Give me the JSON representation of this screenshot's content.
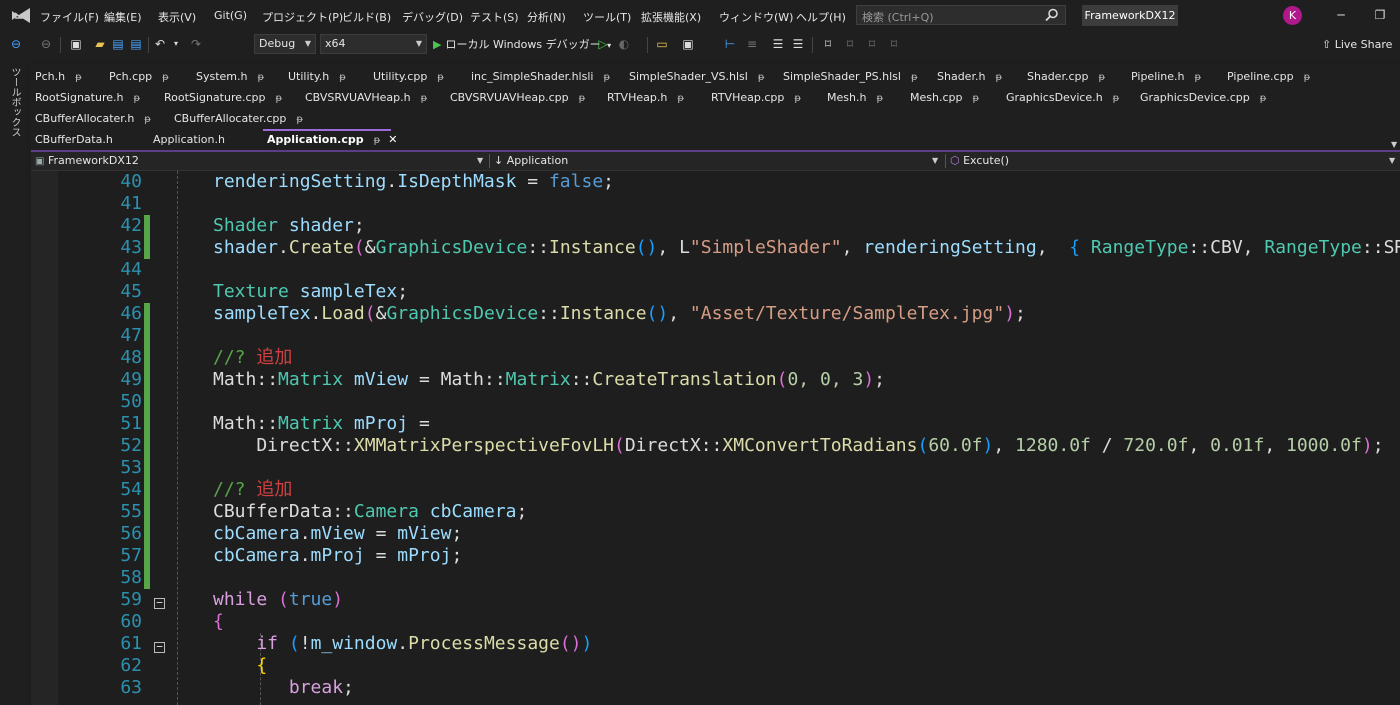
{
  "menu": {
    "items": [
      "ファイル(F)",
      "編集(E)",
      "表示(V)",
      "Git(G)",
      "プロジェクト(P)",
      "ビルド(B)",
      "デバッグ(D)",
      "テスト(S)",
      "分析(N)",
      "ツール(T)",
      "拡張機能(X)",
      "ウィンドウ(W)",
      "ヘルプ(H)"
    ],
    "search_placeholder": "検索 (Ctrl+Q)",
    "solution_name": "FrameworkDX12",
    "avatar_initial": "K"
  },
  "toolbar": {
    "config": "Debug",
    "platform": "x64",
    "run_label": "ローカル Windows デバッガー",
    "live_share": "Live Share"
  },
  "toolbox_label": "ツールボックス",
  "tabs": {
    "row1": [
      "Pch.h",
      "Pch.cpp",
      "System.h",
      "Utility.h",
      "Utility.cpp",
      "inc_SimpleShader.hlsli",
      "SimpleShader_VS.hlsl",
      "SimpleShader_PS.hlsl",
      "Shader.h",
      "Shader.cpp",
      "Pipeline.h",
      "Pipeline.cpp"
    ],
    "row2": [
      "RootSignature.h",
      "RootSignature.cpp",
      "CBVSRVUAVHeap.h",
      "CBVSRVUAVHeap.cpp",
      "RTVHeap.h",
      "RTVHeap.cpp",
      "Mesh.h",
      "Mesh.cpp",
      "GraphicsDevice.h",
      "GraphicsDevice.cpp"
    ],
    "row3": [
      "CBufferAllocater.h",
      "CBufferAllocater.cpp"
    ],
    "row4": [
      "CBufferData.h",
      "Application.h"
    ],
    "active": "Application.cpp"
  },
  "navbar": {
    "project": "FrameworkDX12",
    "scope": "Application",
    "member": "Excute()"
  },
  "editor": {
    "lines": [
      {
        "n": "40",
        "tokens": [
          [
            "renderingSetting",
            "var"
          ],
          [
            ".",
            "plain"
          ],
          [
            "IsDepthMask",
            "var"
          ],
          [
            " = ",
            "plain"
          ],
          [
            "false",
            "kw"
          ],
          [
            ";",
            "plain"
          ]
        ]
      },
      {
        "n": "41",
        "tokens": []
      },
      {
        "n": "42",
        "tokens": [
          [
            "Shader",
            "type"
          ],
          [
            " ",
            "plain"
          ],
          [
            "shader",
            "var"
          ],
          [
            ";",
            "plain"
          ]
        ]
      },
      {
        "n": "43",
        "tokens": [
          [
            "shader",
            "var"
          ],
          [
            ".",
            "plain"
          ],
          [
            "Create",
            "func"
          ],
          [
            "(",
            "br2"
          ],
          [
            "&",
            "plain"
          ],
          [
            "GraphicsDevice",
            "type"
          ],
          [
            "::",
            "plain"
          ],
          [
            "Instance",
            "func"
          ],
          [
            "()",
            "br3"
          ],
          [
            ", ",
            "plain"
          ],
          [
            "L",
            "plain"
          ],
          [
            "\"SimpleShader\"",
            "str"
          ],
          [
            ", ",
            "plain"
          ],
          [
            "renderingSetting",
            "var"
          ],
          [
            ", ",
            "plain"
          ],
          [
            " { ",
            "br3"
          ],
          [
            "RangeType",
            "type"
          ],
          [
            "::",
            "plain"
          ],
          [
            "CBV",
            "plain"
          ],
          [
            ", ",
            "plain"
          ],
          [
            "RangeType",
            "type"
          ],
          [
            "::",
            "plain"
          ],
          [
            "SRV",
            "plain"
          ],
          [
            " }",
            "br3"
          ],
          [
            ")",
            "br2"
          ],
          [
            ";",
            "plain"
          ]
        ]
      },
      {
        "n": "44",
        "tokens": []
      },
      {
        "n": "45",
        "tokens": [
          [
            "Texture",
            "type"
          ],
          [
            " ",
            "plain"
          ],
          [
            "sampleTex",
            "var"
          ],
          [
            ";",
            "plain"
          ]
        ]
      },
      {
        "n": "46",
        "tokens": [
          [
            "sampleTex",
            "var"
          ],
          [
            ".",
            "plain"
          ],
          [
            "Load",
            "func"
          ],
          [
            "(",
            "br2"
          ],
          [
            "&",
            "plain"
          ],
          [
            "GraphicsDevice",
            "type"
          ],
          [
            "::",
            "plain"
          ],
          [
            "Instance",
            "func"
          ],
          [
            "()",
            "br3"
          ],
          [
            ", ",
            "plain"
          ],
          [
            "\"Asset/Texture/SampleTex.jpg\"",
            "str"
          ],
          [
            ")",
            "br2"
          ],
          [
            ";",
            "plain"
          ]
        ]
      },
      {
        "n": "47",
        "tokens": []
      },
      {
        "n": "48",
        "tokens": [
          [
            "//? ",
            "cmt"
          ],
          [
            "追加",
            "cmtred"
          ]
        ]
      },
      {
        "n": "49",
        "tokens": [
          [
            "Math",
            "plain"
          ],
          [
            "::",
            "plain"
          ],
          [
            "Matrix",
            "type"
          ],
          [
            " ",
            "plain"
          ],
          [
            "mView",
            "var"
          ],
          [
            " = ",
            "plain"
          ],
          [
            "Math",
            "plain"
          ],
          [
            "::",
            "plain"
          ],
          [
            "Matrix",
            "type"
          ],
          [
            "::",
            "plain"
          ],
          [
            "CreateTranslation",
            "func"
          ],
          [
            "(",
            "br2"
          ],
          [
            "0, 0, 3",
            "num"
          ],
          [
            ")",
            "br2"
          ],
          [
            ";",
            "plain"
          ]
        ]
      },
      {
        "n": "50",
        "tokens": []
      },
      {
        "n": "51",
        "tokens": [
          [
            "Math",
            "plain"
          ],
          [
            "::",
            "plain"
          ],
          [
            "Matrix",
            "type"
          ],
          [
            " ",
            "plain"
          ],
          [
            "mProj",
            "var"
          ],
          [
            " =",
            "plain"
          ]
        ]
      },
      {
        "n": "52",
        "tokens": [
          [
            "    DirectX",
            "plain"
          ],
          [
            "::",
            "plain"
          ],
          [
            "XMMatrixPerspectiveFovLH",
            "func"
          ],
          [
            "(",
            "br2"
          ],
          [
            "DirectX",
            "plain"
          ],
          [
            "::",
            "plain"
          ],
          [
            "XMConvertToRadians",
            "func"
          ],
          [
            "(",
            "br3"
          ],
          [
            "60.0f",
            "num"
          ],
          [
            ")",
            "br3"
          ],
          [
            ", ",
            "plain"
          ],
          [
            "1280.0f",
            "num"
          ],
          [
            " / ",
            "plain"
          ],
          [
            "720.0f",
            "num"
          ],
          [
            ", ",
            "plain"
          ],
          [
            "0.01f",
            "num"
          ],
          [
            ", ",
            "plain"
          ],
          [
            "1000.0f",
            "num"
          ],
          [
            ")",
            "br2"
          ],
          [
            ";",
            "plain"
          ]
        ]
      },
      {
        "n": "53",
        "tokens": []
      },
      {
        "n": "54",
        "tokens": [
          [
            "//? ",
            "cmt"
          ],
          [
            "追加",
            "cmtred"
          ]
        ]
      },
      {
        "n": "55",
        "tokens": [
          [
            "CBufferData",
            "plain"
          ],
          [
            "::",
            "plain"
          ],
          [
            "Camera",
            "type"
          ],
          [
            " ",
            "plain"
          ],
          [
            "cbCamera",
            "var"
          ],
          [
            ";",
            "plain"
          ]
        ]
      },
      {
        "n": "56",
        "tokens": [
          [
            "cbCamera",
            "var"
          ],
          [
            ".",
            "plain"
          ],
          [
            "mView",
            "var"
          ],
          [
            " = ",
            "plain"
          ],
          [
            "mView",
            "var"
          ],
          [
            ";",
            "plain"
          ]
        ]
      },
      {
        "n": "57",
        "tokens": [
          [
            "cbCamera",
            "var"
          ],
          [
            ".",
            "plain"
          ],
          [
            "mProj",
            "var"
          ],
          [
            " = ",
            "plain"
          ],
          [
            "mProj",
            "var"
          ],
          [
            ";",
            "plain"
          ]
        ]
      },
      {
        "n": "58",
        "tokens": []
      },
      {
        "n": "59",
        "tokens": [
          [
            "while",
            "ctrl"
          ],
          [
            " ",
            "plain"
          ],
          [
            "(",
            "br2"
          ],
          [
            "true",
            "kw"
          ],
          [
            ")",
            "br2"
          ]
        ]
      },
      {
        "n": "60",
        "tokens": [
          [
            "{",
            "br2"
          ]
        ]
      },
      {
        "n": "61",
        "tokens": [
          [
            "    if",
            "ctrl"
          ],
          [
            " ",
            "plain"
          ],
          [
            "(",
            "br3"
          ],
          [
            "!",
            "plain"
          ],
          [
            "m_window",
            "var"
          ],
          [
            ".",
            "plain"
          ],
          [
            "ProcessMessage",
            "func"
          ],
          [
            "()",
            "br2"
          ],
          [
            ")",
            "br3"
          ]
        ]
      },
      {
        "n": "62",
        "tokens": [
          [
            "    {",
            "br1"
          ]
        ]
      },
      {
        "n": "63",
        "tokens": [
          [
            "       ",
            "plain"
          ],
          [
            "break",
            "ctrl"
          ],
          [
            ";",
            "plain"
          ]
        ]
      }
    ]
  }
}
